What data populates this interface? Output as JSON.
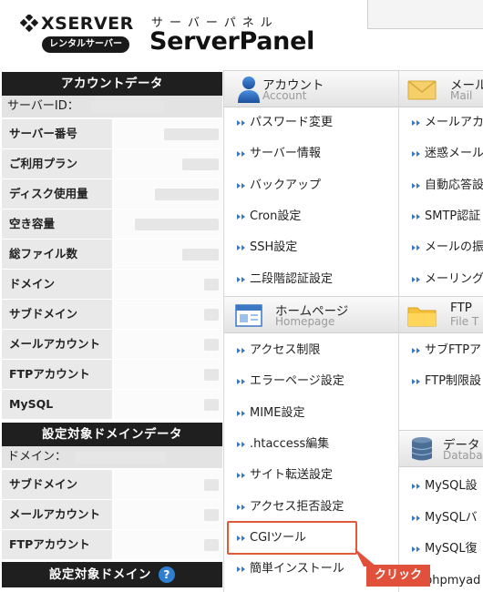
{
  "header": {
    "logo_text": "XSERVER",
    "logo_sub": "レンタルサーバー",
    "panel_sub": "サーバーパネル",
    "panel_title": "ServerPanel"
  },
  "sidebar": {
    "account_title": "アカウントデータ",
    "server_id_label": "サーバーID：",
    "account_rows": [
      {
        "label": "サーバー番号"
      },
      {
        "label": "ご利用プラン"
      },
      {
        "label": "ディスク使用量"
      },
      {
        "label": "空き容量"
      },
      {
        "label": "総ファイル数"
      },
      {
        "label": "ドメイン"
      },
      {
        "label": "サブドメイン"
      },
      {
        "label": "メールアカウント"
      },
      {
        "label": "FTPアカウント"
      },
      {
        "label": "MySQL"
      }
    ],
    "domain_title": "設定対象ドメインデータ",
    "domain_label": "ドメイン：",
    "domain_rows": [
      {
        "label": "サブドメイン"
      },
      {
        "label": "メールアカウント"
      },
      {
        "label": "FTPアカウント"
      }
    ],
    "target_title": "設定対象ドメイン",
    "help_glyph": "?"
  },
  "sections": {
    "account": {
      "title_jp": "アカウント",
      "title_en": "Account",
      "icon": "user-icon",
      "items": [
        "パスワード変更",
        "サーバー情報",
        "バックアップ",
        "Cron設定",
        "SSH設定",
        "二段階認証設定"
      ]
    },
    "mail": {
      "title_jp": "メール",
      "title_en": "Mail",
      "icon": "envelope-icon",
      "items": [
        "メールアカ",
        "迷惑メール",
        "自動応答設",
        "SMTP認証",
        "メールの振",
        "メーリング"
      ]
    },
    "homepage": {
      "title_jp": "ホームページ",
      "title_en": "Homepage",
      "icon": "browser-window-icon",
      "items": [
        "アクセス制限",
        "エラーページ設定",
        "MIME設定",
        ".htaccess編集",
        "サイト転送設定",
        "アクセス拒否設定",
        "CGIツール",
        "簡単インストール"
      ]
    },
    "ftp": {
      "title_jp": "FTP",
      "title_en": "File T",
      "icon": "folder-icon",
      "items": [
        "サブFTPア",
        "FTP制限設"
      ]
    },
    "database": {
      "title_jp": "データ",
      "title_en": "Databa",
      "icon": "database-icon",
      "items": [
        "MySQL設",
        "MySQLバ",
        "MySQL復",
        "phpmyad"
      ]
    }
  },
  "callout": {
    "label": "クリック",
    "color": "#e0503a"
  },
  "colors": {
    "sidebar_title_bg": "#1f1f1f",
    "accent_blue": "#2f7fd1",
    "highlight": "#e05a3a"
  }
}
